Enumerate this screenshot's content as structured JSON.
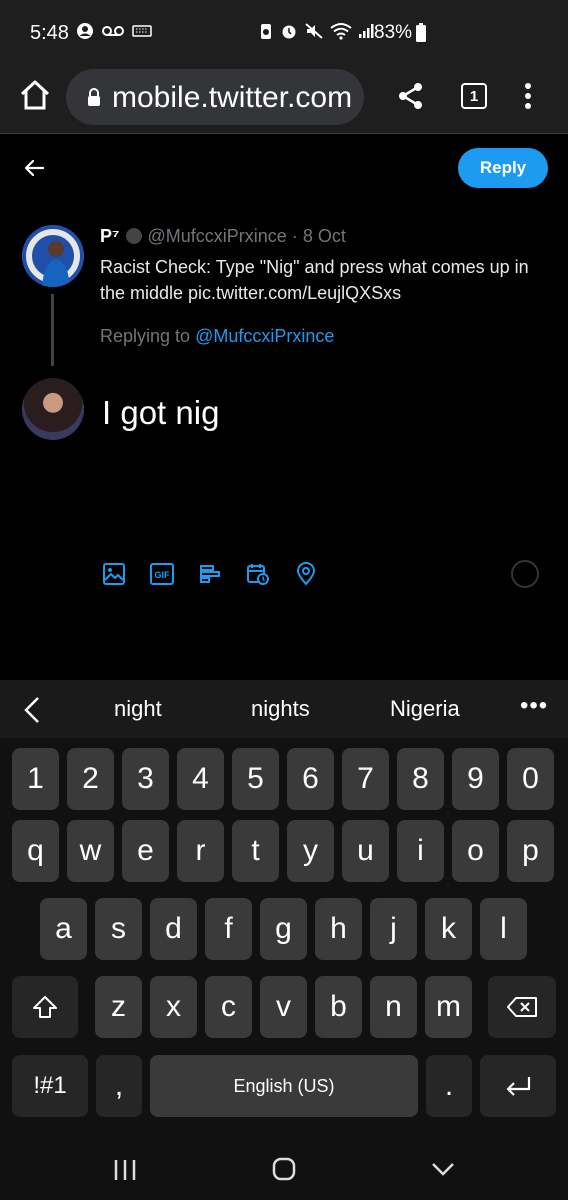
{
  "status_bar": {
    "time": "5:48",
    "battery": "83%"
  },
  "browser": {
    "url": "mobile.twitter.com",
    "tab_count": "1"
  },
  "compose": {
    "reply_label": "Reply",
    "original": {
      "name": "P⁷",
      "handle": "@MufccxiPrxince",
      "dot": "·",
      "date": "8 Oct",
      "text": "Racist Check: Type \"Nig\" and press what comes up in the middle pic.twitter.com/LeujlQXSxs"
    },
    "replying_to_prefix": "Replying to",
    "replying_to_handle": "@MufccxiPrxince",
    "draft_text": "I got nig"
  },
  "keyboard": {
    "suggestions": [
      "night",
      "nights",
      "Nigeria"
    ],
    "row_numbers": [
      "1",
      "2",
      "3",
      "4",
      "5",
      "6",
      "7",
      "8",
      "9",
      "0"
    ],
    "row1": [
      "q",
      "w",
      "e",
      "r",
      "t",
      "y",
      "u",
      "i",
      "o",
      "p"
    ],
    "row2": [
      "a",
      "s",
      "d",
      "f",
      "g",
      "h",
      "j",
      "k",
      "l"
    ],
    "row3": [
      "z",
      "x",
      "c",
      "v",
      "b",
      "n",
      "m"
    ],
    "symbols_label": "!#1",
    "comma": ",",
    "space_label": "English (US)",
    "period": "."
  },
  "colors": {
    "accent": "#1d9bf0",
    "background": "#000000",
    "muted": "#71767b"
  }
}
